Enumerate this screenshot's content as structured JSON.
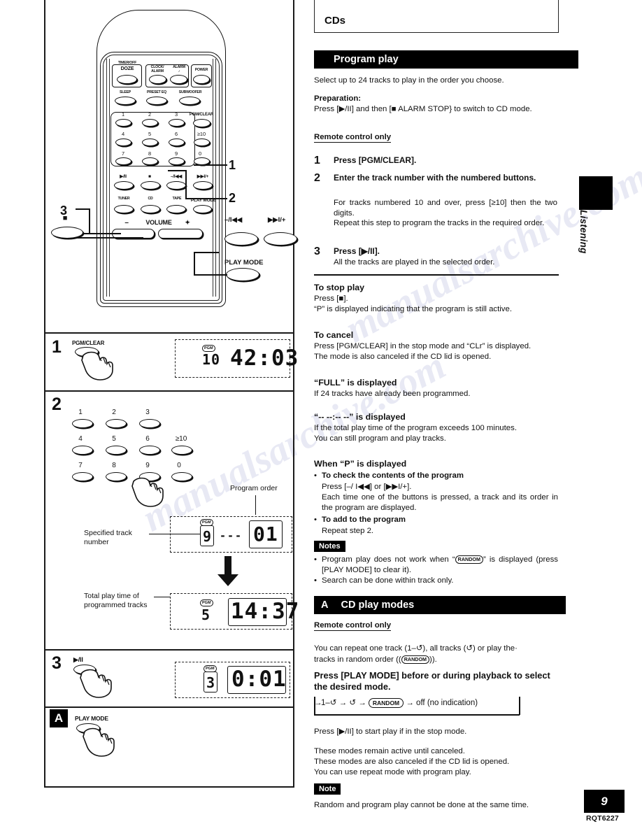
{
  "page": {
    "number": "9",
    "code": "RQT6227",
    "side_tab_label": "Listening",
    "top_box_title": "CDs"
  },
  "sections": {
    "program_play": {
      "bar_title": "Program play",
      "intro": "Select up to 24 tracks to play in the order you choose.",
      "preparation_label": "Preparation:",
      "preparation_text": "Press [▶/II] and then [■ ALARM STOP} to switch to CD mode.",
      "remote_only": "Remote control only",
      "steps": [
        {
          "num": "1",
          "title": "Press [PGM/CLEAR].",
          "body": []
        },
        {
          "num": "2",
          "title": "Enter the track number with the numbered buttons.",
          "body": [
            "For tracks numbered 10 and over, press [≥10] then the two digits.",
            "Repeat this step to program the tracks in the required order."
          ]
        },
        {
          "num": "3",
          "title": "Press [▶/II].",
          "body": [
            "All the tracks are played in the selected order."
          ]
        }
      ],
      "subsections": [
        {
          "heading": "To stop play",
          "lines": [
            "Press [■].",
            "“P” is displayed indicating that the program is still active."
          ]
        },
        {
          "heading": "To cancel",
          "lines": [
            "Press [PGM/CLEAR] in the stop mode and “CLr” is displayed.",
            "The mode is also canceled if the CD lid is opened."
          ]
        },
        {
          "heading": "“FULL” is displayed",
          "lines": [
            "If 24 tracks have already been programmed."
          ]
        },
        {
          "heading": "“-- --:-- --” is displayed",
          "lines": [
            "If the total play time of the program exceeds 100 minutes.",
            "You can still program and play tracks."
          ]
        }
      ],
      "when_p": {
        "heading": "When “P” is displayed",
        "bullets": [
          {
            "title": "To check the contents of the program",
            "lines": [
              "Press [–/ I◀◀] or [▶▶I/+].",
              "Each time one of the buttons is pressed, a track and its order in the program are displayed."
            ]
          },
          {
            "title": "To add to the program",
            "lines": [
              "Repeat step 2."
            ]
          }
        ]
      },
      "notes": {
        "badge": "Notes",
        "items": [
          {
            "pre": "Program play does not work when “",
            "pill": "RANDOM",
            "post": "” is displayed (press [PLAY MODE] to clear it)."
          },
          {
            "pre": "Search can be done within track only.",
            "pill": "",
            "post": ""
          }
        ]
      }
    },
    "cd_play_modes": {
      "letter": "A",
      "bar_title": "CD play modes",
      "remote_only": "Remote control only",
      "intro_a": "You can repeat one track (1–↺), all tracks (↺) or play the·",
      "intro_b_pre": "tracks in random order ((",
      "intro_b_pill": "RANDOM",
      "intro_b_post": ")).",
      "bold_instruction": "Press [PLAY MODE] before or during playback to select the desired mode.",
      "cycle": {
        "item1": "1–↺",
        "item2": "↺",
        "item3": "RANDOM",
        "item4": "off (no indication)"
      },
      "after_lines": [
        "Press [▶/II] to start play if in the stop mode.",
        "These modes remain active until canceled.",
        "These modes are also canceled if the CD lid is opened.",
        "You can use repeat mode with program play."
      ],
      "note": {
        "badge": "Note",
        "text": "Random and program play cannot be done at the same time."
      }
    }
  },
  "remote_diagram": {
    "callouts": [
      {
        "id": "1",
        "label": "1"
      },
      {
        "id": "2",
        "label": "2"
      },
      {
        "id": "3",
        "label": "3"
      }
    ],
    "top_keys": [
      {
        "label": "TIMER/OFF",
        "sub": "DOZE"
      },
      {
        "label": "CLOCK/",
        "sub": "ALARM"
      },
      {
        "label": "ALARM",
        "sub": "♪"
      },
      {
        "label": "POWER",
        "sub": ""
      }
    ],
    "second_row_keys": [
      {
        "label": "SLEEP"
      },
      {
        "label": "PRESET EQ"
      },
      {
        "label": "SUBWOOFER"
      }
    ],
    "number_keys": [
      "1",
      "2",
      "3",
      "PGM/CLEAR",
      "4",
      "5",
      "6",
      "≥10",
      "7",
      "8",
      "9",
      "0"
    ],
    "transport_keys": [
      "▶/II",
      "■",
      "–/I◀◀",
      "▶▶I/+"
    ],
    "source_keys": [
      "TUNER",
      "CD",
      "TAPE"
    ],
    "play_mode_key": "PLAY MODE",
    "volume_label": "VOLUME",
    "volume_minus": "–",
    "volume_plus": "✦",
    "external_labels": {
      "rew": "–/I◀◀",
      "ffwd": "▶▶I/+",
      "play_mode": "PLAY MODE"
    }
  },
  "steps_panel": [
    {
      "num": "1",
      "button_caption": "PGM/CLEAR",
      "display": {
        "pgm": "PGM",
        "track": "10",
        "time": "42:03"
      }
    },
    {
      "num": "2",
      "keys": [
        "1",
        "2",
        "3",
        "4",
        "5",
        "6",
        "≥10",
        "7",
        "8",
        "9",
        "0"
      ],
      "callout_program_order": "Program order",
      "callout_specified_track": "Specified track number",
      "callout_total_time": "Total play time of programmed tracks",
      "display_first": {
        "pgm": "PGM",
        "track": "9",
        "dashes": "---",
        "order": "01"
      },
      "display_second": {
        "pgm": "PGM",
        "track": "5",
        "time": "14:37"
      }
    },
    {
      "num": "3",
      "button_caption": "▶/II",
      "display": {
        "pgm": "PGM",
        "track": "3",
        "time": "0:01"
      }
    },
    {
      "num": "A",
      "button_caption": "PLAY MODE"
    }
  ],
  "watermark": {
    "text_1": "manualsarchive.com",
    "text_2": "manualsarchive.com"
  }
}
